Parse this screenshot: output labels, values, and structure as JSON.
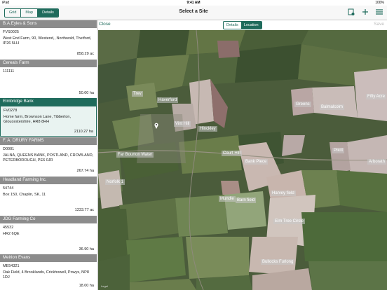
{
  "status": {
    "carrier": "iPad",
    "time": "9:41 AM",
    "battery": "100%"
  },
  "nav": {
    "tabs": [
      "Grid",
      "Map",
      "Details"
    ],
    "title": "Select a Site"
  },
  "sites": [
    {
      "name": "B.A.Eyles & Sons",
      "code": "FVS0025",
      "address": "West End Farm, 90, Westend,, Northwold, Thetford, IP26 5LH",
      "area": "858.29 ac",
      "selected": false
    },
    {
      "name": "Cereals Farm",
      "code": "111111",
      "address": "",
      "area": "50.00 ha",
      "selected": false
    },
    {
      "name": "Elmbridge Bank",
      "code": "FV0278",
      "address": "Home farm, Brownson Lane, Tibberton, Gloucestershire, HR8 8HH",
      "area": "2110.27 ha",
      "selected": true
    },
    {
      "name": "F. A. DRURY FARMS",
      "code": "D0001",
      "address": "JALNA, QUEENS BANK, POSTLAND, CROWLAND, PETERBOROUGH, PE6 0JR",
      "area": "267.74 ha",
      "selected": false
    },
    {
      "name": "Headland Farming Inc.",
      "code": "54744",
      "address": "Box 150, Chaplin, SK, 11",
      "area": "1233.77 ac",
      "selected": false
    },
    {
      "name": "JDG Farming Co",
      "code": "45532",
      "address": "HR2 6QE",
      "area": "36.90 ha",
      "selected": false
    },
    {
      "name": "Meirion Evans",
      "code": "ME54321",
      "address": "Oak Field, 4 Brooklands, Crickhowell, Powys, NP8 1DJ",
      "area": "18.00 ha",
      "selected": false
    }
  ],
  "toolbar": {
    "close": "Close",
    "tabs": [
      "Details",
      "Location"
    ],
    "save": "Save"
  },
  "map": {
    "fields": [
      "Trev",
      "Haverford",
      "Fifty Acre",
      "Greens",
      "Balmalcolm",
      "Vint Hill",
      "Hinckley",
      "Far Bourton Water",
      "Court Hill",
      "Pikitt",
      "Arborath",
      "Bank Piece",
      "Norfolk 1",
      "Harvey field",
      "Mundle",
      "Barn field",
      "Elm Tree Circle",
      "Bullocks Furlong"
    ],
    "legal": "Legal"
  },
  "icons": {
    "sync": "sync-icon",
    "add": "plus-icon",
    "menu": "menu-icon",
    "pin": "location-pin-icon"
  },
  "colors": {
    "accent": "#1f6b5c",
    "header_gray": "#8c8c8c"
  }
}
